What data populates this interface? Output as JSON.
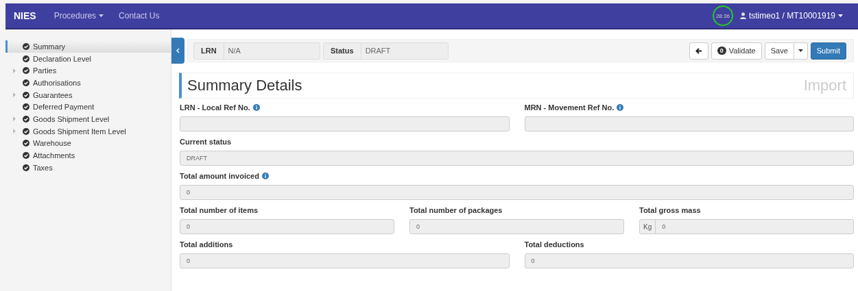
{
  "navbar": {
    "brand": "NIES",
    "links": [
      {
        "label": "Procedures",
        "dropdown": true
      },
      {
        "label": "Contact Us",
        "dropdown": false
      }
    ],
    "timer": "28:36",
    "user": "tstimeo1 / MT10001919"
  },
  "sidebar": {
    "items": [
      {
        "label": "Summary",
        "selected": true,
        "expandable": false
      },
      {
        "label": "Declaration Level",
        "selected": false,
        "expandable": false
      },
      {
        "label": "Parties",
        "selected": false,
        "expandable": true
      },
      {
        "label": "Authorisations",
        "selected": false,
        "expandable": false
      },
      {
        "label": "Guarantees",
        "selected": false,
        "expandable": true
      },
      {
        "label": "Deferred Payment",
        "selected": false,
        "expandable": false
      },
      {
        "label": "Goods Shipment Level",
        "selected": false,
        "expandable": true
      },
      {
        "label": "Goods Shipment Item Level",
        "selected": false,
        "expandable": true
      },
      {
        "label": "Warehouse",
        "selected": false,
        "expandable": false
      },
      {
        "label": "Attachments",
        "selected": false,
        "expandable": false
      },
      {
        "label": "Taxes",
        "selected": false,
        "expandable": false
      }
    ]
  },
  "toolbar": {
    "lrn_label": "LRN",
    "lrn_value": "N/A",
    "status_label": "Status",
    "status_value": "DRAFT",
    "validate_count": "0",
    "validate": "Validate",
    "save": "Save",
    "submit": "Submit"
  },
  "panel": {
    "title": "Summary Details",
    "type": "Import"
  },
  "form_rows": [
    [
      {
        "label": "LRN - Local Ref No.",
        "info": true
      },
      {
        "label": "MRN - Movement Ref No.",
        "info": true
      }
    ],
    [
      {
        "label": "Current status",
        "info": false,
        "value": "DRAFT"
      }
    ],
    [
      {
        "label": "Total amount invoiced",
        "info": true,
        "value": "0"
      }
    ],
    [
      {
        "label": "Total number of items",
        "info": false,
        "value": "0"
      },
      {
        "label": "Total number of packages",
        "info": false,
        "value": "0"
      },
      {
        "label": "Total gross mass",
        "info": false,
        "value": "0",
        "unit": "Kg"
      }
    ],
    [
      {
        "label": "Total additions",
        "info": false,
        "value": "0"
      },
      {
        "label": "Total deductions",
        "info": false,
        "value": "0"
      }
    ]
  ]
}
